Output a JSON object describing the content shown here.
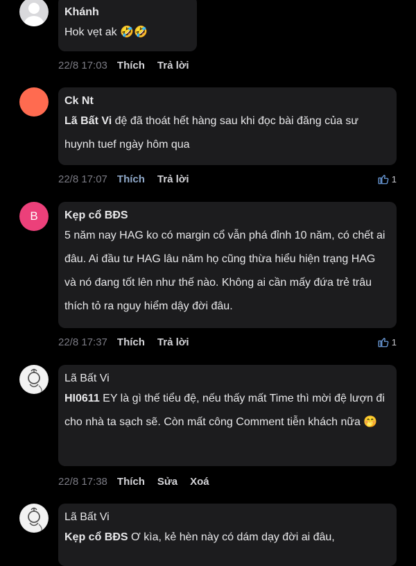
{
  "comments": [
    {
      "author": "Khánh",
      "text": "Hok vẹt ak 🤣🤣",
      "time": "22/8 17:03",
      "actions": [
        "Thích",
        "Trả lời"
      ],
      "likes": ""
    },
    {
      "author": "Ck Nt",
      "mention": "Lã Bất Vi",
      "text": " đệ đã thoát hết hàng sau khi đọc bài đăng của sư huynh tuef ngày hôm qua",
      "time": "22/8 17:07",
      "actions": [
        "Thích",
        "Trả lời"
      ],
      "likes": "1"
    },
    {
      "author": "Kẹp cổ BĐS",
      "avatar_letter": "B",
      "text": "5 năm nay HAG ko có margin cổ vẫn phá đỉnh 10 năm, có chết ai đâu. Ai đầu tư HAG lâu năm họ cũng thừa hiểu hiện trạng HAG và nó đang tốt lên như thế nào. Không ai cần mấy đứa trẻ trâu thích tỏ ra nguy hiểm dậy đời đâu.",
      "time": "22/8 17:37",
      "actions": [
        "Thích",
        "Trả lời"
      ],
      "likes": "1"
    },
    {
      "author": "Lã Bất Vi",
      "mention": "HI0611",
      "text": " EY là gì thế tiểu đệ, nếu thấy mất Time thì mời đệ lượn đi cho nhà ta sạch sẽ. Còn mất công Comment tiễn khách nữa 🤭",
      "time": "22/8 17:38",
      "actions": [
        "Thích",
        "Sửa",
        "Xoá"
      ],
      "likes": ""
    },
    {
      "author": "Lã Bất Vi",
      "mention": "Kẹp cổ BĐS",
      "text": " Ơ kìa, kẻ hèn này có dám dạy đời ai đâu,",
      "time": "",
      "actions": [],
      "likes": ""
    }
  ],
  "colors": {
    "background": "#000000",
    "bubble": "#1c1c1e",
    "liked_action": "#8fa8c8",
    "avatar_ck_nt": "#ff6b50",
    "avatar_kep_co": "#ec407a"
  }
}
